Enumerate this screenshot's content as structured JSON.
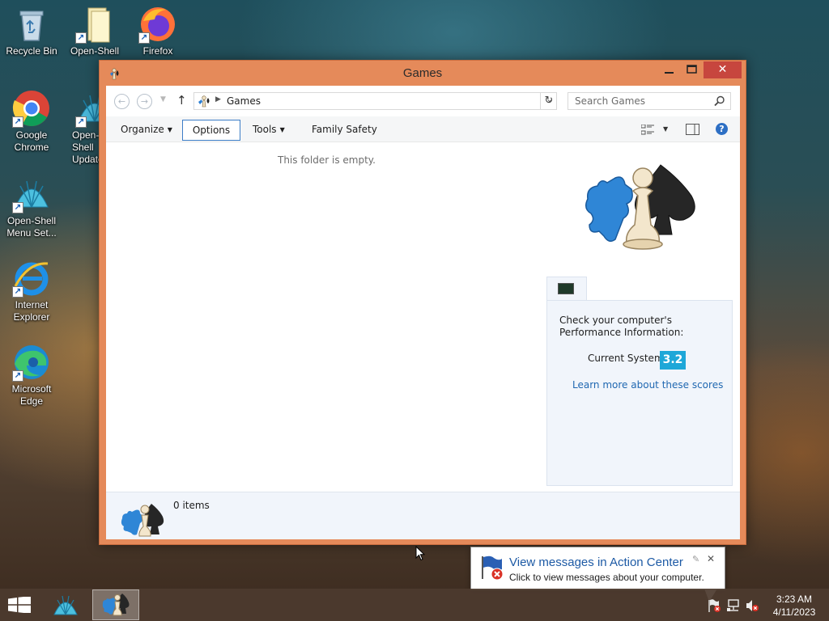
{
  "desktop": {
    "icons": [
      {
        "label": "Recycle Bin"
      },
      {
        "label": "Open-Shell"
      },
      {
        "label": "Firefox"
      },
      {
        "label": "Google Chrome"
      },
      {
        "label": "Open-Shell Update"
      },
      {
        "label": "Open-Shell Menu Set..."
      },
      {
        "label": "Internet Explorer"
      },
      {
        "label": "Microsoft Edge"
      }
    ]
  },
  "window": {
    "title": "Games",
    "address": {
      "location": "Games"
    },
    "search": {
      "placeholder": "Search Games"
    },
    "commands": {
      "organize": "Organize",
      "options": "Options",
      "tools": "Tools",
      "family_safety": "Family Safety"
    },
    "empty_message": "This folder is empty.",
    "performance": {
      "info": "Check your computer's Performance Information:",
      "label": "Current System",
      "score": "3.2",
      "link": "Learn more about these scores"
    },
    "status": {
      "items": "0 items"
    }
  },
  "notification": {
    "title": "View messages in Action Center",
    "message": "Click to view messages about your computer."
  },
  "taskbar": {
    "time": "3:23 AM",
    "date": "4/11/2023"
  },
  "colors": {
    "title_bar": "#e58a5a",
    "close_button": "#c7463e",
    "score_badge": "#1ea7d8",
    "link": "#1f67b1"
  }
}
